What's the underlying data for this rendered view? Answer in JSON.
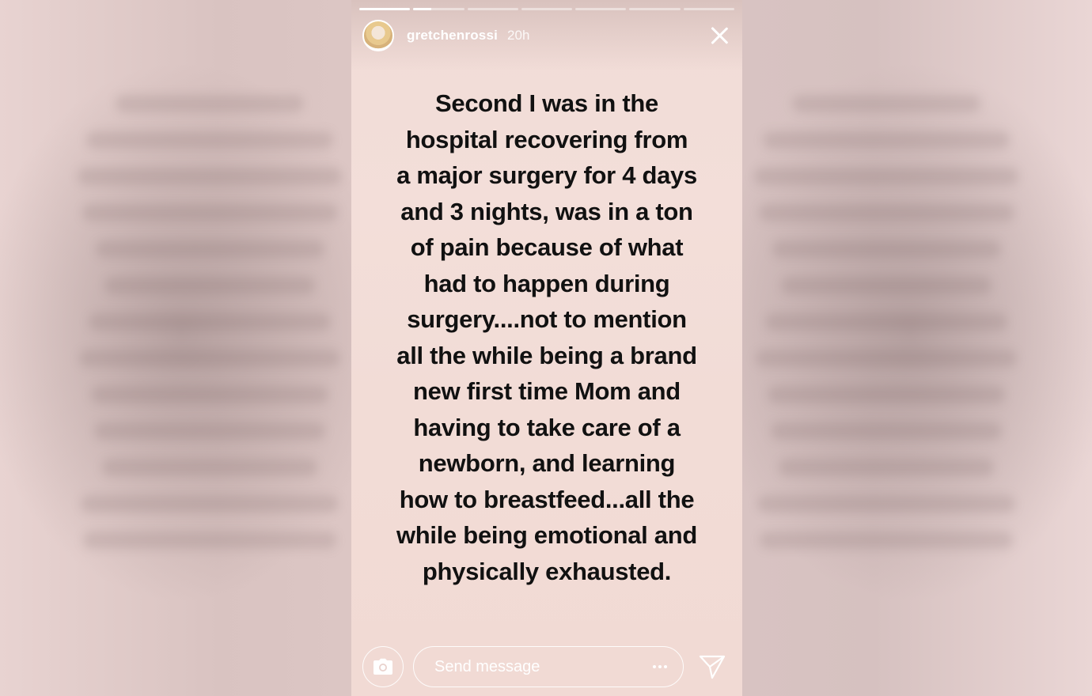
{
  "story": {
    "username": "gretchenrossi",
    "time_ago": "20h",
    "progress": {
      "segments": 7,
      "completed": 1,
      "current_fraction": 0.35
    },
    "text_lines": [
      "Second I was in the",
      "hospital recovering  from",
      "a major surgery for 4 days",
      "and 3 nights, was in a ton",
      "of pain because of what",
      "had to happen during",
      "surgery....not to mention",
      "all the while being a brand",
      "new first time Mom and",
      "having to take care of a",
      "newborn, and learning",
      "how to breastfeed...all the",
      "while being emotional and",
      "physically exhausted."
    ],
    "text_color": "#111111",
    "background_color": "#f2dcd6"
  },
  "footer": {
    "message_placeholder": "Send message"
  },
  "icons": {
    "close": "close-icon",
    "camera": "camera-icon",
    "more": "more-dots-icon",
    "send": "send-icon"
  }
}
